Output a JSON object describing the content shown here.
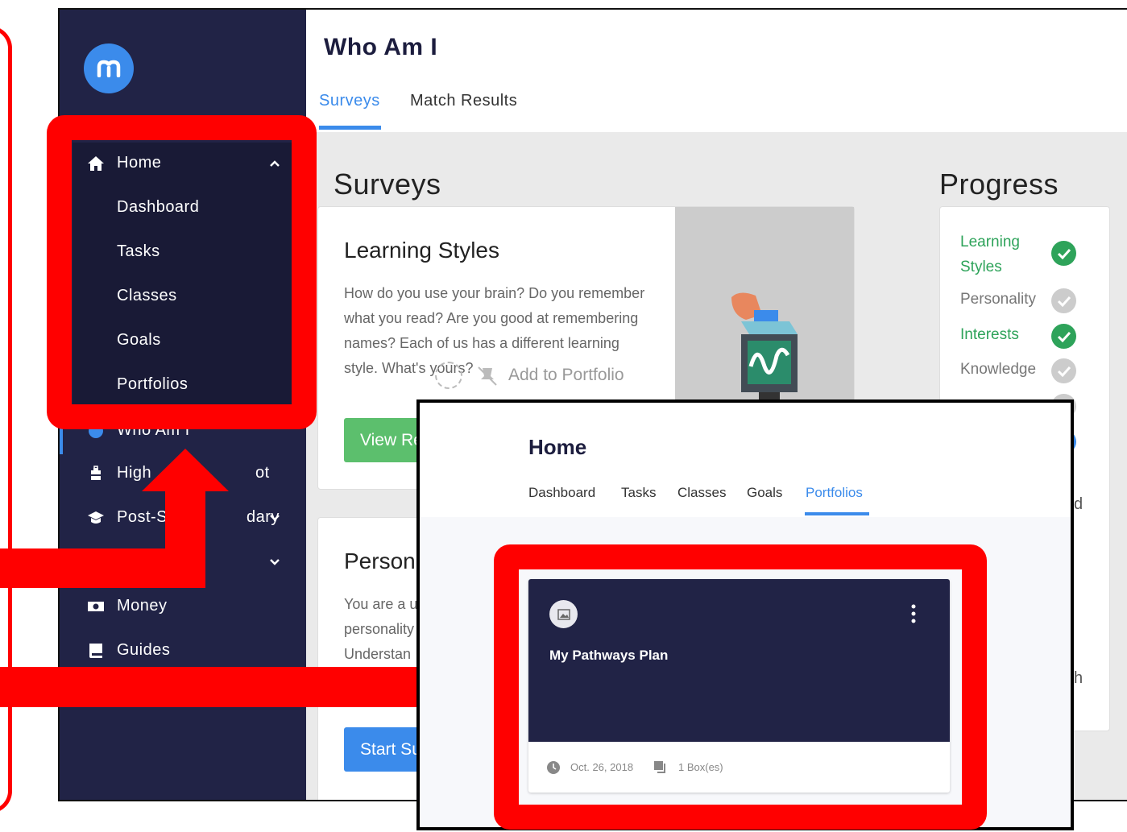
{
  "sidebar": {
    "home": {
      "label": "Home",
      "subitems": [
        "Dashboard",
        "Tasks",
        "Classes",
        "Goals",
        "Portfolios"
      ]
    },
    "items": [
      "Who Am I",
      "High School",
      "Post-Secondary",
      "",
      "Money",
      "Guides"
    ],
    "visible": {
      "high": "High",
      "high_tail": "ot",
      "post": "Post-S",
      "post_tail": "dary",
      "whoami": "Who Am I"
    }
  },
  "header": {
    "title": "Who Am I",
    "tabs": [
      "Surveys",
      "Match Results"
    ]
  },
  "surveys": {
    "title": "Surveys",
    "card1": {
      "title": "Learning Styles",
      "description": "How do you use your brain? Do you remember what you read? Are you good at remembering names? Each of us has a different learning style. What's yours?",
      "button": "View Re",
      "overlay_label": "Add to Portfolio"
    },
    "card2": {
      "title": "Person",
      "lines": [
        "You are a u",
        "personality",
        "Understan"
      ],
      "button": "Start Su"
    }
  },
  "progress": {
    "title": "Progress",
    "items": [
      {
        "label": "Learning Styles",
        "line1": "Learning",
        "line2": "Styles",
        "done": true
      },
      {
        "label": "Personality",
        "done": false
      },
      {
        "label": "Interests",
        "done": true
      },
      {
        "label": "Knowledge",
        "done": false
      }
    ],
    "partial": {
      "a": "d",
      "b": "h"
    }
  },
  "overlay": {
    "title": "Home",
    "tabs": [
      "Dashboard",
      "Tasks",
      "Classes",
      "Goals",
      "Portfolios"
    ],
    "active_tab": "Portfolios",
    "portfolio": {
      "title": "My Pathways Plan",
      "date": "Oct. 26, 2018",
      "boxes": "1 Box(es)"
    }
  },
  "colors": {
    "sidebar": "#212346",
    "accent": "#3b8beb",
    "highlight": "#ff0000",
    "success": "#2ea35a",
    "button_green": "#5cbf6d"
  }
}
